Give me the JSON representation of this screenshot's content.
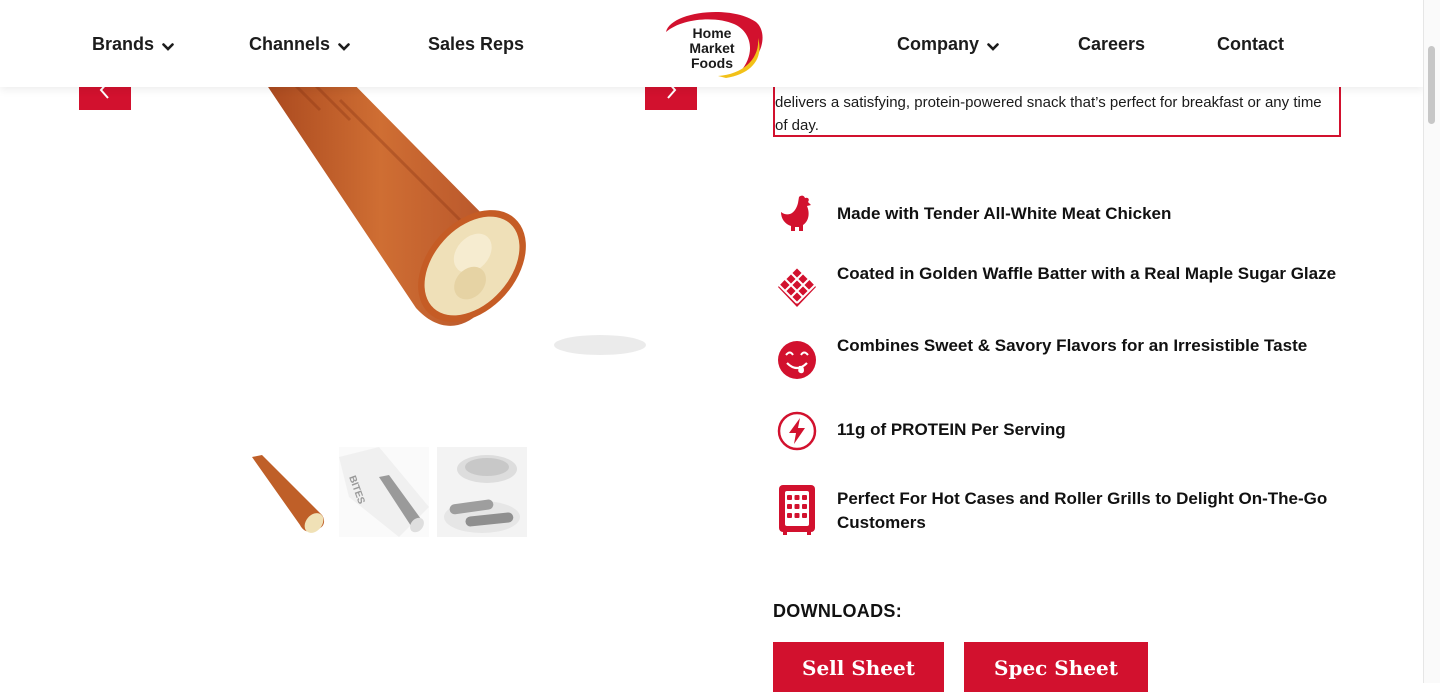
{
  "header": {
    "nav_left": [
      {
        "label": "Brands"
      },
      {
        "label": "Channels"
      },
      {
        "label": "Sales Reps"
      }
    ],
    "logo_lines": [
      "Home",
      "Market",
      "Foods"
    ],
    "nav_right": [
      {
        "label": "Company"
      },
      {
        "label": "Careers"
      },
      {
        "label": "Contact"
      }
    ]
  },
  "gallery": {
    "prev_icon": "chevron-left-icon",
    "next_icon": "chevron-right-icon",
    "thumbnails": [
      "product-stick",
      "product-package",
      "serving-plate"
    ]
  },
  "description": {
    "text": "delivers a satisfying, protein-powered snack that’s perfect for breakfast or any time of day."
  },
  "features": [
    {
      "icon": "chicken-icon",
      "text": "Made with Tender All-White Meat Chicken"
    },
    {
      "icon": "waffle-icon",
      "text": "Coated in Golden Waffle Batter with a Real Maple Sugar Glaze"
    },
    {
      "icon": "smiley-tongue-icon",
      "text": "Combines Sweet & Savory Flavors for an Irresistible Taste"
    },
    {
      "icon": "lightning-icon",
      "text": "11g of PROTEIN Per Serving"
    },
    {
      "icon": "roller-grill-icon",
      "text": "Perfect For Hot Cases and Roller Grills to Delight On-The-Go Customers"
    }
  ],
  "downloads": {
    "title": "DOWNLOADS:",
    "buttons": [
      {
        "label": "Sell Sheet"
      },
      {
        "label": "Spec Sheet"
      }
    ]
  },
  "colors": {
    "brand_red": "#d2112e",
    "logo_yellow": "#f2c118",
    "text_dark": "#111111"
  }
}
